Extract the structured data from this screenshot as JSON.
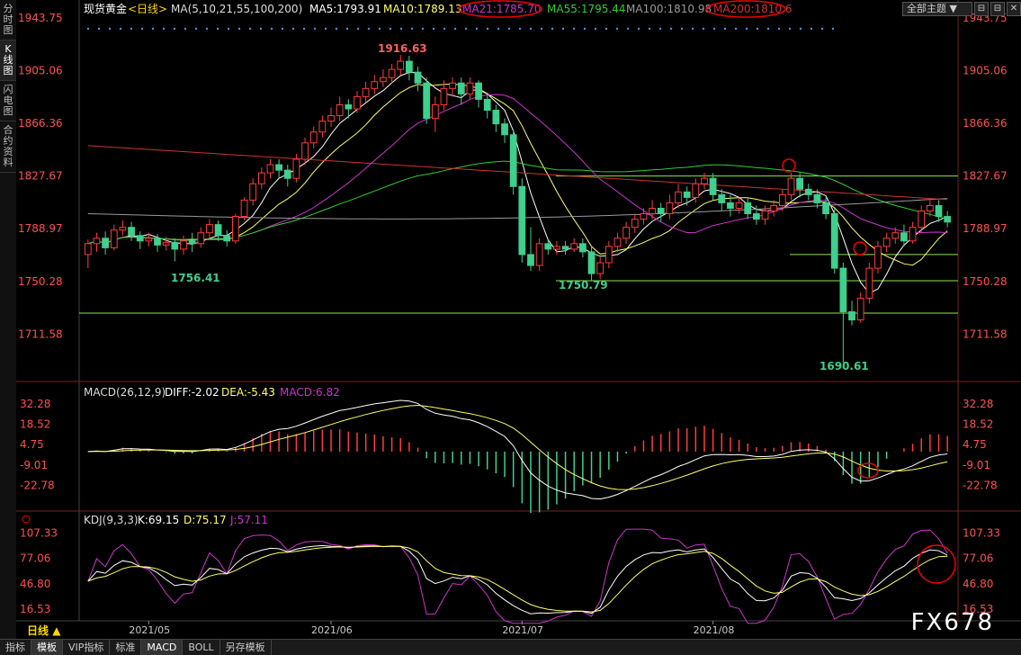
{
  "sidebar": {
    "items": [
      "分时图",
      "K线图",
      "闪电图",
      "合约资料"
    ]
  },
  "header": {
    "instrument": "现货黄金",
    "period_tag": "<日线>",
    "ma_label": "MA(5,10,21,55,100,200)",
    "ma5": "MA5:1793.91",
    "ma10": "MA10:1789.13",
    "ma21": "MA21:1785.70",
    "ma55": "MA55:1795.44",
    "ma100": "MA100:1810.98",
    "ma200": "MA200:1810.6"
  },
  "toolbar": {
    "theme": "全部主题",
    "theme_arrow": "▼",
    "btn1": "⊟",
    "btn2": "⊟",
    "btn3": "✕"
  },
  "price_axis": [
    "1943.75",
    "1905.06",
    "1866.36",
    "1827.67",
    "1788.97",
    "1750.28",
    "1711.58"
  ],
  "annotations": {
    "high": "1916.63",
    "low1": "1756.41",
    "low2": "1750.79",
    "low3": "1690.61"
  },
  "macd": {
    "label": "MACD(26,12,9)",
    "diff": "DIFF:-2.02",
    "dea": "DEA:-5.43",
    "macd": "MACD:6.82",
    "axis": [
      "32.28",
      "18.52",
      "4.75",
      "-9.01",
      "-22.78"
    ]
  },
  "kdj": {
    "label": "KDJ(9,3,3)",
    "k": "K:69.15",
    "d": "D:75.17",
    "j": "J:57.11",
    "axis": [
      "107.33",
      "77.06",
      "46.80",
      "16.53"
    ]
  },
  "time_axis": [
    "2021/05",
    "2021/06",
    "2021/07",
    "2021/08"
  ],
  "period_label": "日线",
  "period_arrow": "▲",
  "bottom_tabs": [
    "指标",
    "模板",
    "VIP指标",
    "标准",
    "MACD",
    "BOLL",
    "另存模板"
  ],
  "watermark": "FX678",
  "colors": {
    "up": "#ff3b3b",
    "down": "#3fcf8e",
    "ma5": "#ffffff",
    "ma10": "#ffff66",
    "ma21": "#cc33cc",
    "ma55": "#33cc33",
    "ma100": "#999999",
    "ma200": "#cc3333"
  },
  "chart_data": {
    "type": "candlestick",
    "title": "现货黄金 日线",
    "ylim": [
      1690,
      1943.75
    ],
    "candles": [
      [
        1770,
        1778,
        1760,
        1781
      ],
      [
        1778,
        1782,
        1772,
        1786
      ],
      [
        1782,
        1775,
        1770,
        1787
      ],
      [
        1775,
        1788,
        1773,
        1792
      ],
      [
        1788,
        1790,
        1784,
        1795
      ],
      [
        1790,
        1784,
        1780,
        1794
      ],
      [
        1784,
        1780,
        1774,
        1787
      ],
      [
        1780,
        1782,
        1776,
        1786
      ],
      [
        1782,
        1777,
        1772,
        1785
      ],
      [
        1777,
        1779,
        1773,
        1783
      ],
      [
        1779,
        1774,
        1765,
        1782
      ],
      [
        1774,
        1780,
        1770,
        1784
      ],
      [
        1780,
        1778,
        1772,
        1786
      ],
      [
        1778,
        1786,
        1775,
        1790
      ],
      [
        1786,
        1792,
        1782,
        1796
      ],
      [
        1792,
        1784,
        1780,
        1795
      ],
      [
        1784,
        1780,
        1776,
        1788
      ],
      [
        1780,
        1798,
        1778,
        1800
      ],
      [
        1798,
        1810,
        1795,
        1812
      ],
      [
        1810,
        1822,
        1806,
        1826
      ],
      [
        1822,
        1830,
        1818,
        1834
      ],
      [
        1830,
        1836,
        1826,
        1840
      ],
      [
        1836,
        1832,
        1826,
        1840
      ],
      [
        1832,
        1826,
        1820,
        1836
      ],
      [
        1826,
        1840,
        1823,
        1844
      ],
      [
        1840,
        1852,
        1836,
        1856
      ],
      [
        1852,
        1860,
        1848,
        1864
      ],
      [
        1860,
        1868,
        1856,
        1872
      ],
      [
        1868,
        1872,
        1864,
        1878
      ],
      [
        1872,
        1880,
        1868,
        1886
      ],
      [
        1880,
        1877,
        1870,
        1884
      ],
      [
        1877,
        1886,
        1874,
        1890
      ],
      [
        1886,
        1892,
        1882,
        1897
      ],
      [
        1892,
        1897,
        1888,
        1902
      ],
      [
        1897,
        1900,
        1893,
        1906
      ],
      [
        1900,
        1906,
        1896,
        1910
      ],
      [
        1906,
        1912,
        1902,
        1916.63
      ],
      [
        1912,
        1904,
        1898,
        1916
      ],
      [
        1904,
        1896,
        1890,
        1908
      ],
      [
        1896,
        1870,
        1866,
        1900
      ],
      [
        1870,
        1880,
        1860,
        1886
      ],
      [
        1880,
        1892,
        1876,
        1898
      ],
      [
        1892,
        1896,
        1886,
        1900
      ],
      [
        1896,
        1888,
        1880,
        1900
      ],
      [
        1888,
        1896,
        1884,
        1900
      ],
      [
        1896,
        1884,
        1878,
        1898
      ],
      [
        1884,
        1876,
        1870,
        1888
      ],
      [
        1876,
        1866,
        1860,
        1880
      ],
      [
        1866,
        1858,
        1852,
        1870
      ],
      [
        1858,
        1820,
        1814,
        1862
      ],
      [
        1820,
        1770,
        1764,
        1826
      ],
      [
        1770,
        1762,
        1758,
        1790
      ],
      [
        1762,
        1778,
        1758,
        1782
      ],
      [
        1778,
        1774,
        1770,
        1782
      ],
      [
        1774,
        1776,
        1770,
        1780
      ],
      [
        1776,
        1774,
        1770,
        1780
      ],
      [
        1774,
        1778,
        1772,
        1782
      ],
      [
        1778,
        1772,
        1768,
        1782
      ],
      [
        1772,
        1756,
        1750.79,
        1776
      ],
      [
        1756,
        1764,
        1752,
        1768
      ],
      [
        1764,
        1776,
        1760,
        1780
      ],
      [
        1776,
        1782,
        1772,
        1786
      ],
      [
        1782,
        1790,
        1778,
        1794
      ],
      [
        1790,
        1796,
        1786,
        1800
      ],
      [
        1796,
        1800,
        1792,
        1804
      ],
      [
        1800,
        1804,
        1796,
        1810
      ],
      [
        1804,
        1800,
        1794,
        1808
      ],
      [
        1800,
        1808,
        1796,
        1814
      ],
      [
        1808,
        1816,
        1804,
        1822
      ],
      [
        1816,
        1812,
        1806,
        1820
      ],
      [
        1812,
        1822,
        1808,
        1826
      ],
      [
        1822,
        1826,
        1818,
        1830
      ],
      [
        1826,
        1814,
        1810,
        1830
      ],
      [
        1814,
        1808,
        1802,
        1818
      ],
      [
        1808,
        1804,
        1798,
        1814
      ],
      [
        1804,
        1808,
        1800,
        1812
      ],
      [
        1808,
        1800,
        1796,
        1812
      ],
      [
        1800,
        1796,
        1792,
        1806
      ],
      [
        1796,
        1802,
        1792,
        1806
      ],
      [
        1802,
        1806,
        1798,
        1810
      ],
      [
        1806,
        1814,
        1802,
        1818
      ],
      [
        1814,
        1826,
        1810,
        1830
      ],
      [
        1826,
        1818,
        1812,
        1830
      ],
      [
        1818,
        1814,
        1810,
        1822
      ],
      [
        1814,
        1808,
        1804,
        1818
      ],
      [
        1808,
        1800,
        1796,
        1812
      ],
      [
        1800,
        1760,
        1756,
        1804
      ],
      [
        1760,
        1728,
        1690.61,
        1764
      ],
      [
        1728,
        1722,
        1718,
        1736
      ],
      [
        1722,
        1738,
        1720,
        1742
      ],
      [
        1738,
        1760,
        1734,
        1764
      ],
      [
        1760,
        1776,
        1756,
        1780
      ],
      [
        1776,
        1782,
        1772,
        1786
      ],
      [
        1782,
        1786,
        1778,
        1790
      ],
      [
        1786,
        1780,
        1776,
        1792
      ],
      [
        1780,
        1790,
        1778,
        1794
      ],
      [
        1790,
        1802,
        1786,
        1806
      ],
      [
        1802,
        1806,
        1798,
        1810
      ],
      [
        1806,
        1798,
        1794,
        1810
      ],
      [
        1798,
        1793.9,
        1790,
        1802
      ]
    ],
    "hlines": [
      1827.67,
      1770,
      1750.79,
      1727
    ]
  }
}
